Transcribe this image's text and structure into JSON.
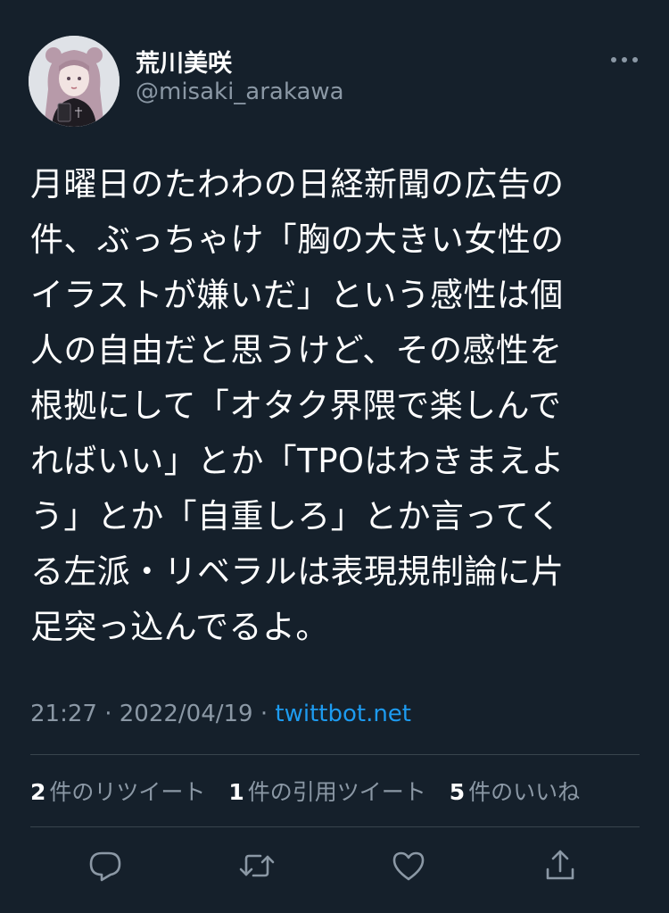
{
  "author": {
    "display_name": "荒川美咲",
    "handle": "@misaki_arakawa",
    "avatar_icon": "avatar-illustration"
  },
  "tweet": {
    "lines": [
      "月曜日のたわわの日経新聞の広告の",
      "件、ぶっちゃけ「胸の大きい女性の",
      "イラストが嫌いだ」という感性は個",
      "人の自由だと思うけど、その感性を",
      "根拠にして「オタク界隈で楽しんで",
      "ればいい」とか「TPOはわきまえよ",
      "う」とか「自重しろ」とか言ってく",
      "る左派・リベラルは表現規制論に片",
      "足突っ込んでるよ。"
    ]
  },
  "meta": {
    "time": "21:27",
    "separator": " · ",
    "date": "2022/04/19",
    "source": "twittbot.net"
  },
  "stats": {
    "retweets": {
      "count": "2",
      "label": "件のリツイート"
    },
    "quotes": {
      "count": "1",
      "label": "件の引用ツイート"
    },
    "likes": {
      "count": "5",
      "label": "件のいいね"
    }
  },
  "actions": {
    "reply_icon": "reply-icon",
    "retweet_icon": "retweet-icon",
    "like_icon": "heart-icon",
    "share_icon": "share-icon"
  },
  "colors": {
    "background": "#15202b",
    "text": "#ffffff",
    "secondary": "#8b98a5",
    "link": "#1d9bf0",
    "divider": "#38444d"
  }
}
